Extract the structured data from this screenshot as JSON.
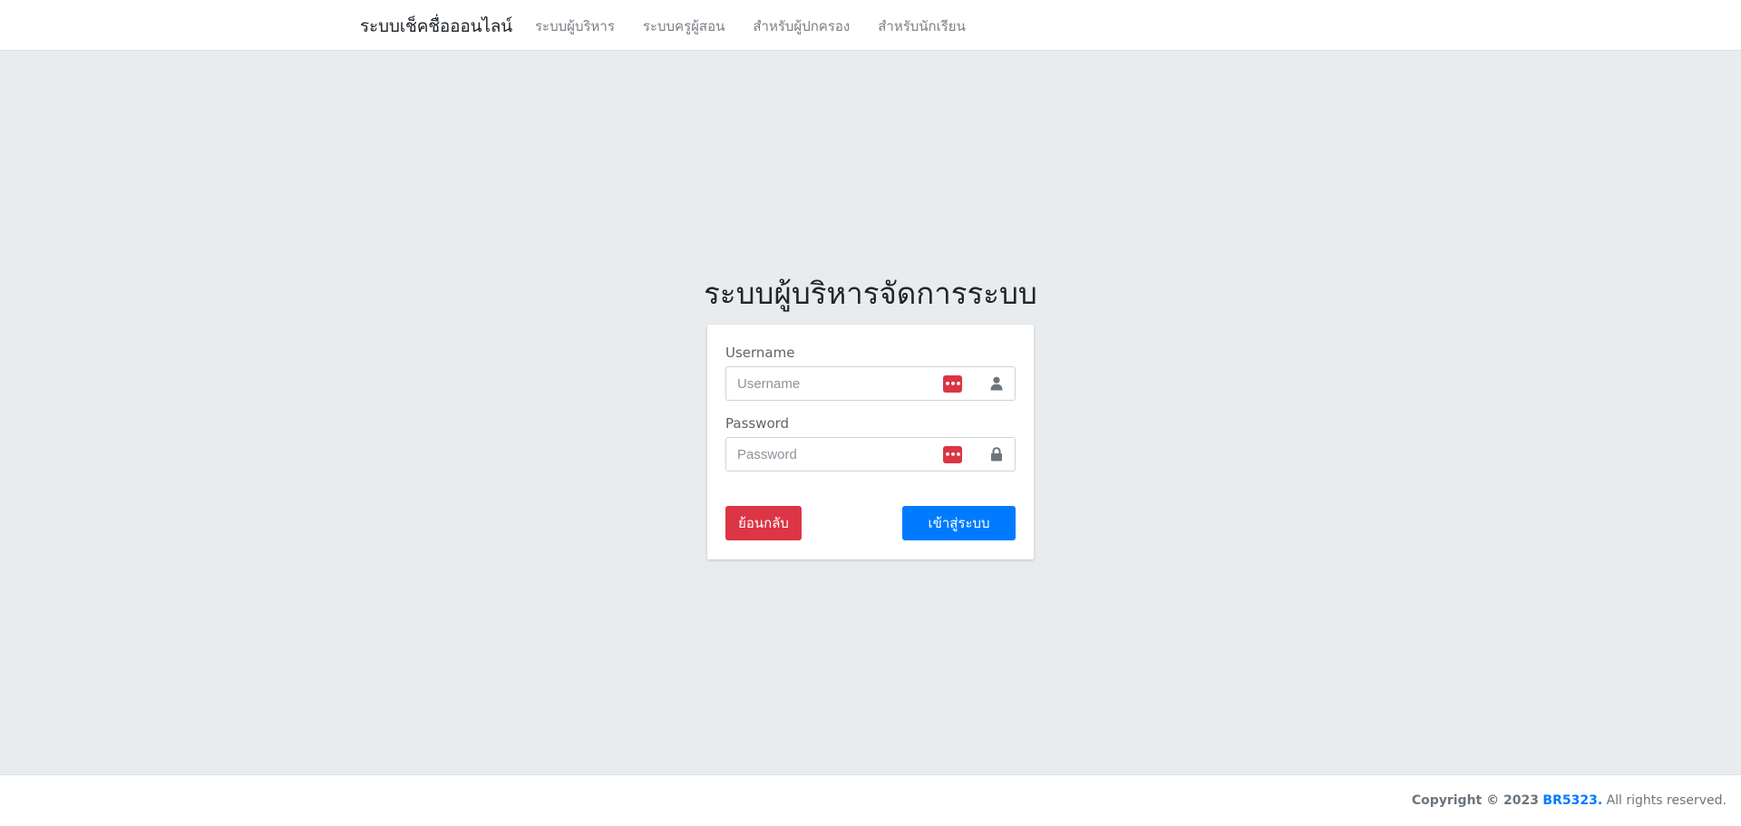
{
  "navbar": {
    "brand": "ระบบเช็คชื่อออนไลน์",
    "links": [
      {
        "label": "ระบบผู้บริหาร"
      },
      {
        "label": "ระบบครูผู้สอน"
      },
      {
        "label": "สำหรับผู้ปกครอง"
      },
      {
        "label": "สำหรับนักเรียน"
      }
    ]
  },
  "login": {
    "title": "ระบบผู้บริหารจัดการระบบ",
    "username_label": "Username",
    "username_placeholder": "Username",
    "password_label": "Password",
    "password_placeholder": "Password",
    "back_button": "ย้อนกลับ",
    "login_button": "เข้าสู่ระบบ",
    "password_manager_icon": "password-manager-icon",
    "username_icon": "user-icon",
    "password_icon": "lock-icon"
  },
  "footer": {
    "copyright_prefix": "Copyright © 2023",
    "brand_link": "BR5323.",
    "suffix": "All rights reserved."
  },
  "colors": {
    "primary": "#007bff",
    "danger": "#dc3545",
    "background": "#e9ecef"
  }
}
